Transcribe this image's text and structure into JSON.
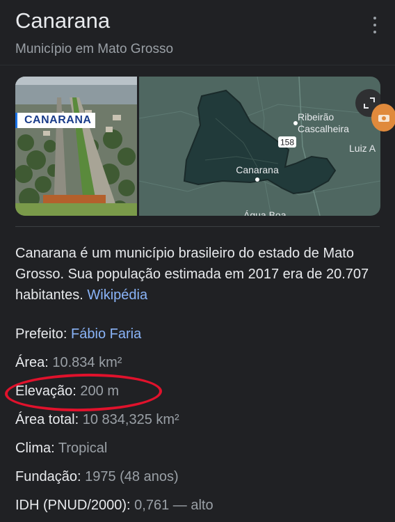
{
  "header": {
    "title": "Canarana",
    "subtitle": "Município em Mato Grosso"
  },
  "media": {
    "photo_badge": "CANARANA",
    "map_labels": {
      "city": "Canarana",
      "city_north_1": "Ribeirão",
      "city_north_2": "Cascalheira",
      "city_east": "Luiz A",
      "road": "158",
      "city_south": "Água Boa"
    }
  },
  "description": {
    "text": "Canarana é um município brasileiro do estado de Mato Grosso. Sua população estimada em 2017 era de 20.707 habitantes. ",
    "source_link": "Wikipédia"
  },
  "facts": [
    {
      "label": "Prefeito: ",
      "value": "Fábio Faria",
      "is_link": true
    },
    {
      "label": "Área: ",
      "value": "10.834 km²",
      "is_link": false
    },
    {
      "label": "Elevação: ",
      "value": "200 m",
      "is_link": false
    },
    {
      "label": "Área total: ",
      "value": "10 834,325 km²",
      "is_link": false
    },
    {
      "label": "Clima: ",
      "value": "Tropical",
      "is_link": false
    },
    {
      "label": "Fundação: ",
      "value": "1975 (48 anos)",
      "is_link": false
    },
    {
      "label": "IDH (PNUD/2000): ",
      "value": "0,761 — alto",
      "is_link": false
    }
  ],
  "colors": {
    "background": "#202124",
    "link": "#8ab4f8",
    "highlight_circle": "#e0122c"
  },
  "icons": [
    "more-vert-icon",
    "expand-icon",
    "camera-icon"
  ]
}
